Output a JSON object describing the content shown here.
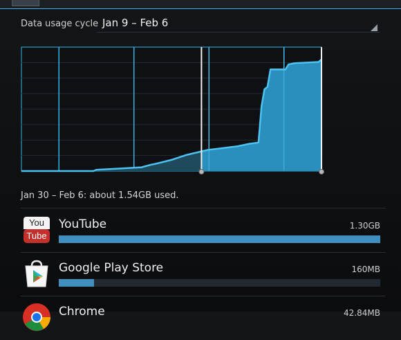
{
  "cycle": {
    "label": "Data usage cycle",
    "value": "Jan 9 – Feb 6"
  },
  "summary": "Jan 30 – Feb 6: about 1.54GB used.",
  "colors": {
    "accent": "#33b5e5",
    "fill": "#2a8fbd",
    "bar": "#3f8fbf",
    "background": "#0d0e10"
  },
  "apps": [
    {
      "name": "YouTube",
      "size": "1.30GB",
      "fraction": 1.0,
      "icon": "youtube-icon",
      "icon_text_top": "You",
      "icon_text_bottom": "Tube"
    },
    {
      "name": "Google Play Store",
      "size": "160MB",
      "fraction": 0.11,
      "icon": "play-store-icon"
    },
    {
      "name": "Chrome",
      "size": "42.84MB",
      "fraction": 0.03,
      "icon": "chrome-icon"
    }
  ],
  "chart_data": {
    "type": "area",
    "period_start_marker": 0.6,
    "period_end_marker": 1.0,
    "series": [
      {
        "values": [
          [
            0,
            0
          ],
          [
            0.24,
            0
          ],
          [
            0.25,
            0.01
          ],
          [
            0.4,
            0.03
          ],
          [
            0.43,
            0.05
          ],
          [
            0.45,
            0.06
          ],
          [
            0.5,
            0.09
          ],
          [
            0.55,
            0.13
          ],
          [
            0.62,
            0.17
          ],
          [
            0.72,
            0.2
          ],
          [
            0.76,
            0.22
          ],
          [
            0.79,
            0.23
          ],
          [
            0.8,
            0.52
          ],
          [
            0.81,
            0.66
          ],
          [
            0.82,
            0.68
          ],
          [
            0.83,
            0.82
          ],
          [
            0.88,
            0.82
          ],
          [
            0.89,
            0.86
          ],
          [
            0.91,
            0.87
          ],
          [
            0.99,
            0.88
          ],
          [
            1.0,
            0.9
          ]
        ]
      }
    ],
    "grid": true,
    "ylim": [
      0,
      1
    ],
    "xlim": [
      0,
      1
    ]
  }
}
